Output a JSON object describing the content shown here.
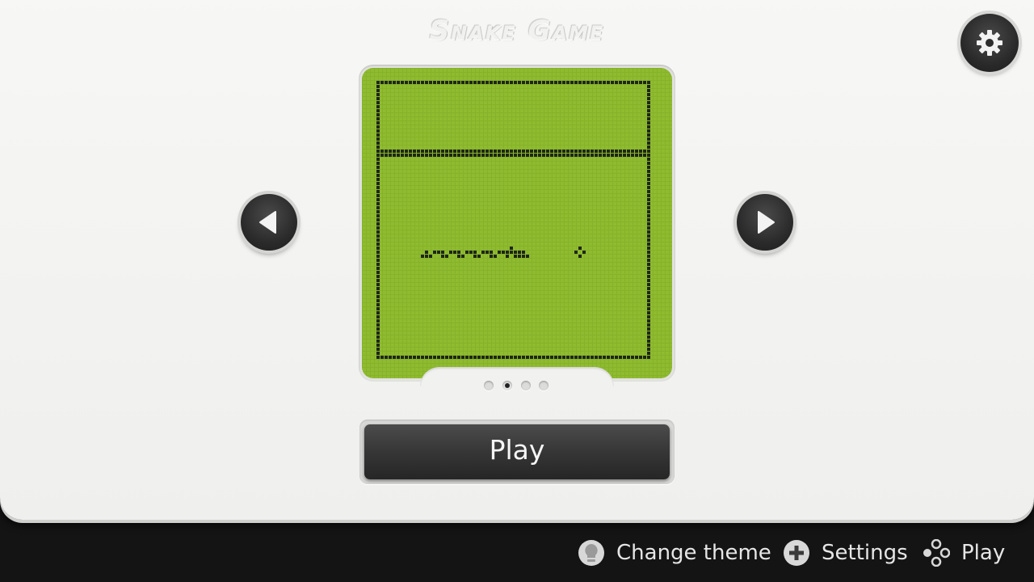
{
  "title": "Snake Game",
  "play_button": {
    "label": "Play"
  },
  "footer": {
    "change_theme": "Change theme",
    "settings": "Settings",
    "play": "Play"
  },
  "carousel": {
    "page_count": 4,
    "active_index": 1
  },
  "icons": {
    "settings": "gear-icon",
    "previous": "arrow-left-icon",
    "next": "arrow-right-icon",
    "change_theme": "bulb-button-icon",
    "settings_footer": "plus-button-icon",
    "play_footer": "dpad-buttons-icon"
  },
  "colors": {
    "lcd_background": "#8fbb30",
    "lcd_pixel": "#1e2617",
    "button_dark": "#333333"
  }
}
